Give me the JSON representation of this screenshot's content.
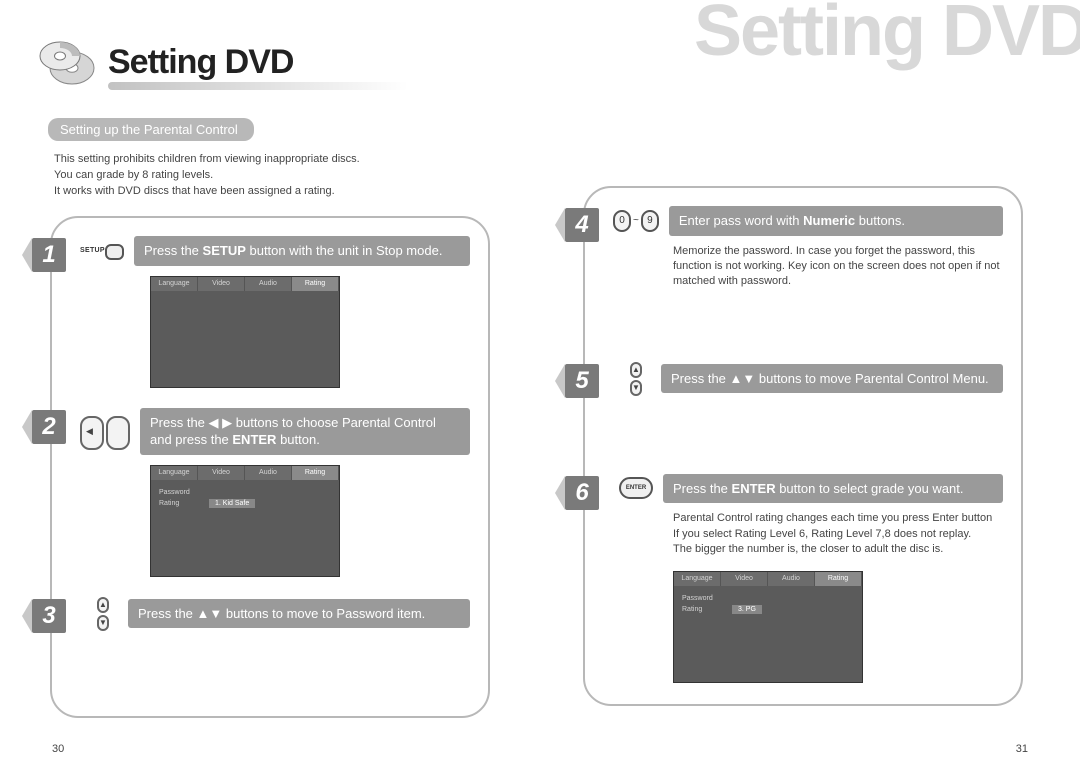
{
  "bg_title": "Setting DVD",
  "page_title": "Setting DVD",
  "subtitle": "Setting up the Parental Control",
  "intro": [
    "This setting prohibits children from viewing inappropriate discs.",
    "You can grade by 8 rating levels.",
    "It works with DVD discs that have been assigned a rating."
  ],
  "screenshots": {
    "tabs": [
      "Language",
      "Video",
      "Audio",
      "Rating"
    ],
    "pw_label": "Password",
    "rating_label": "Rating",
    "rating_value_1": "1. Kid Safe",
    "rating_value_2": "3. PG"
  },
  "steps": {
    "s1": {
      "num": "1",
      "icon_label": "SETUP",
      "text_before": "Press the ",
      "text_bold": "SETUP",
      "text_after": " button with the unit in Stop mode."
    },
    "s2": {
      "num": "2",
      "text_before": "Press the ◀ ▶ buttons to choose Parental Control and press the ",
      "text_bold": "ENTER",
      "text_after": " button."
    },
    "s3": {
      "num": "3",
      "text": "Press the ▲▼ buttons to move to Password item."
    },
    "s4": {
      "num": "4",
      "key0": "0",
      "tilde": "~",
      "key9": "9",
      "text_before": "Enter pass word with ",
      "text_bold": "Numeric",
      "text_after": " buttons.",
      "sub": "Memorize the password. In case you forget the password, this function is not working. Key icon on the screen does not open if not matched with password."
    },
    "s5": {
      "num": "5",
      "text": "Press the  ▲▼  buttons to move Parental Control Menu."
    },
    "s6": {
      "num": "6",
      "enter_label": "ENTER",
      "text_before": "Press the ",
      "text_bold": "ENTER",
      "text_after": " button to select grade you want.",
      "sub": "Parental Control rating changes each time you press Enter button\nIf you select Rating Level 6, Rating Level 7,8 does not replay.\nThe bigger the number is, the closer to adult the disc is."
    }
  },
  "page_left": "30",
  "page_right": "31"
}
